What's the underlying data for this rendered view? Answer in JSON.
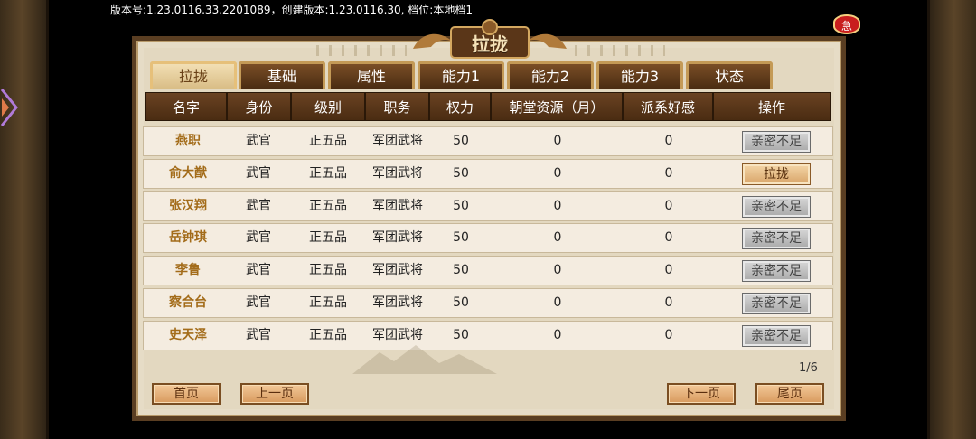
{
  "version_text": "版本号:1.23.0116.33.2201089，创建版本:1.23.0116.30, 档位:本地档1",
  "urgent_label": "急",
  "title": "拉拢",
  "tabs": [
    {
      "label": "拉拢",
      "active": true
    },
    {
      "label": "基础",
      "active": false
    },
    {
      "label": "属性",
      "active": false
    },
    {
      "label": "能力1",
      "active": false
    },
    {
      "label": "能力2",
      "active": false
    },
    {
      "label": "能力3",
      "active": false
    },
    {
      "label": "状态",
      "active": false
    }
  ],
  "columns": [
    "名字",
    "身份",
    "级别",
    "职务",
    "权力",
    "朝堂资源（月）",
    "派系好感",
    "操作"
  ],
  "rows": [
    {
      "name": "燕职",
      "identity": "武官",
      "rank": "正五品",
      "post": "军团武将",
      "power": "50",
      "resource": "0",
      "favor": "0",
      "action": "亲密不足",
      "action_enabled": false
    },
    {
      "name": "俞大猷",
      "identity": "武官",
      "rank": "正五品",
      "post": "军团武将",
      "power": "50",
      "resource": "0",
      "favor": "0",
      "action": "拉拢",
      "action_enabled": true
    },
    {
      "name": "张汉翔",
      "identity": "武官",
      "rank": "正五品",
      "post": "军团武将",
      "power": "50",
      "resource": "0",
      "favor": "0",
      "action": "亲密不足",
      "action_enabled": false
    },
    {
      "name": "岳钟琪",
      "identity": "武官",
      "rank": "正五品",
      "post": "军团武将",
      "power": "50",
      "resource": "0",
      "favor": "0",
      "action": "亲密不足",
      "action_enabled": false
    },
    {
      "name": "李鲁",
      "identity": "武官",
      "rank": "正五品",
      "post": "军团武将",
      "power": "50",
      "resource": "0",
      "favor": "0",
      "action": "亲密不足",
      "action_enabled": false
    },
    {
      "name": "察合台",
      "identity": "武官",
      "rank": "正五品",
      "post": "军团武将",
      "power": "50",
      "resource": "0",
      "favor": "0",
      "action": "亲密不足",
      "action_enabled": false
    },
    {
      "name": "史天泽",
      "identity": "武官",
      "rank": "正五品",
      "post": "军团武将",
      "power": "50",
      "resource": "0",
      "favor": "0",
      "action": "亲密不足",
      "action_enabled": false
    }
  ],
  "page_indicator": "1/6",
  "nav": {
    "first": "首页",
    "prev": "上一页",
    "next": "下一页",
    "last": "尾页"
  },
  "colors": {
    "panel_border": "#5a3e22",
    "header_bg": "#5a3618",
    "name_text": "#a36c1a",
    "tab_active_bg": "#e9d29e",
    "button_active_bg": "#e6b880"
  }
}
